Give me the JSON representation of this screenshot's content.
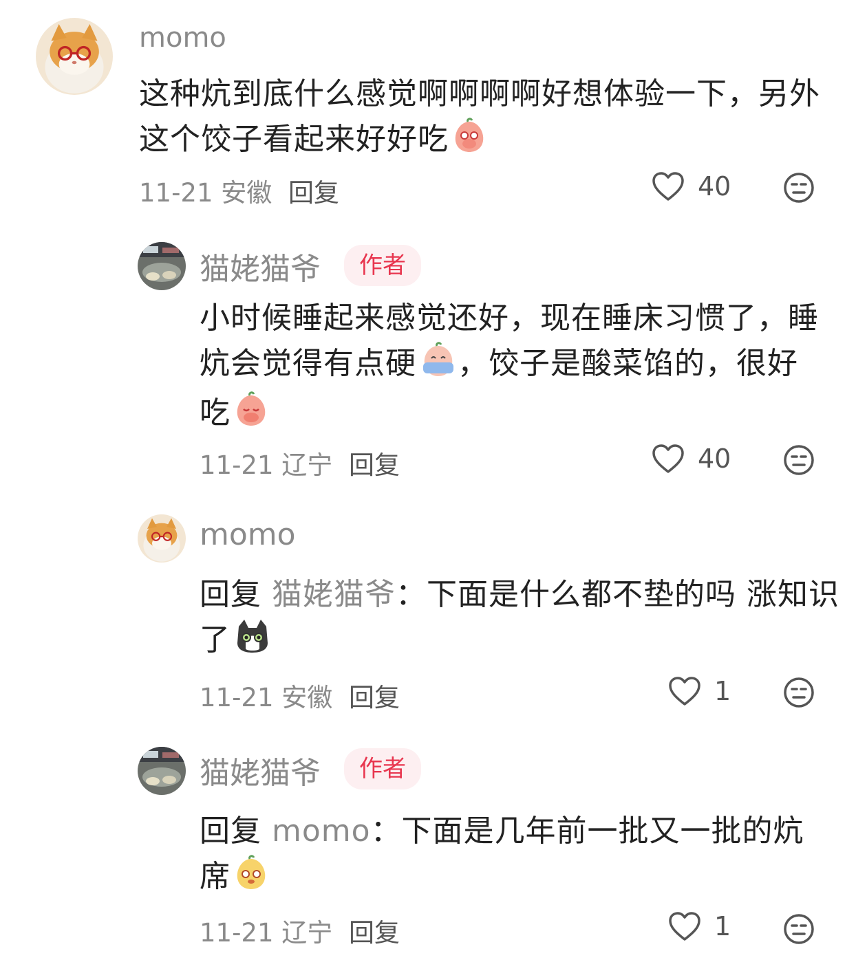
{
  "comments": [
    {
      "username": "momo",
      "text": "这种炕到底什么感觉啊啊啊啊好想体验一下，另外这个饺子看起来好好吃",
      "date": "11-21",
      "location": "安徽",
      "reply_label": "回复",
      "likes": "40"
    },
    {
      "username": "猫姥猫爷",
      "badge": "作者",
      "text_part1": "小时候睡起来感觉还好，现在睡床习惯了，睡炕会觉得有点硬",
      "text_part2": "，饺子是酸菜馅的，很好吃",
      "date": "11-21",
      "location": "辽宁",
      "reply_label": "回复",
      "likes": "40"
    },
    {
      "username": "momo",
      "reply_prefix": "回复",
      "reply_target": "猫姥猫爷",
      "text": "：下面是什么都不垫的吗 涨知识了",
      "date": "11-21",
      "location": "安徽",
      "reply_label": "回复",
      "likes": "1"
    },
    {
      "username": "猫姥猫爷",
      "badge": "作者",
      "reply_prefix": "回复",
      "reply_target": "momo",
      "text": "：下面是几年前一批又一批的炕席",
      "date": "11-21",
      "location": "辽宁",
      "reply_label": "回复",
      "likes": "1"
    }
  ],
  "icons": {
    "like": "heart-outline-icon",
    "dislike": "unamused-face-icon"
  },
  "colors": {
    "accent": "#e8364f",
    "badge_bg": "#fdeff1",
    "muted_text": "#8a8a8a",
    "body_text": "#222222"
  }
}
